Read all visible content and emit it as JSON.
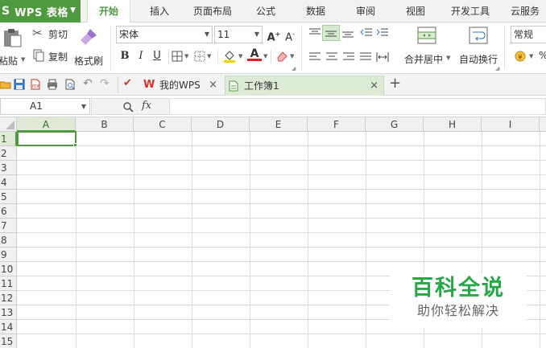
{
  "app": {
    "logo": "S",
    "name": "WPS 表格"
  },
  "menu_tabs": [
    "开始",
    "插入",
    "页面布局",
    "公式",
    "数据",
    "审阅",
    "视图",
    "开发工具",
    "云服务"
  ],
  "ribbon": {
    "paste": "粘贴",
    "cut": "剪切",
    "copy": "复制",
    "format_painter": "格式刷",
    "font_name": "宋体",
    "font_size": "11",
    "bold": "B",
    "italic": "I",
    "underline": "U",
    "merge_center": "合并居中",
    "wrap_text": "自动换行",
    "number_format": "常规",
    "percent": "%"
  },
  "doc_tabs": [
    {
      "label": "我的WPS",
      "active": false
    },
    {
      "label": "工作簿1",
      "active": true
    }
  ],
  "formula_bar": {
    "cell_ref": "A1",
    "fx": "fx",
    "value": ""
  },
  "columns": [
    "A",
    "B",
    "C",
    "D",
    "E",
    "F",
    "G",
    "H",
    "I"
  ],
  "rows": [
    "1",
    "2",
    "3",
    "4",
    "5",
    "6",
    "7",
    "8",
    "9",
    "10",
    "11",
    "12",
    "13",
    "14",
    "15"
  ],
  "watermark": {
    "title": "百科全说",
    "subtitle": "助你轻松解决"
  },
  "colors": {
    "accent": "#4f9a3e",
    "watermark_green": "#27a847"
  }
}
